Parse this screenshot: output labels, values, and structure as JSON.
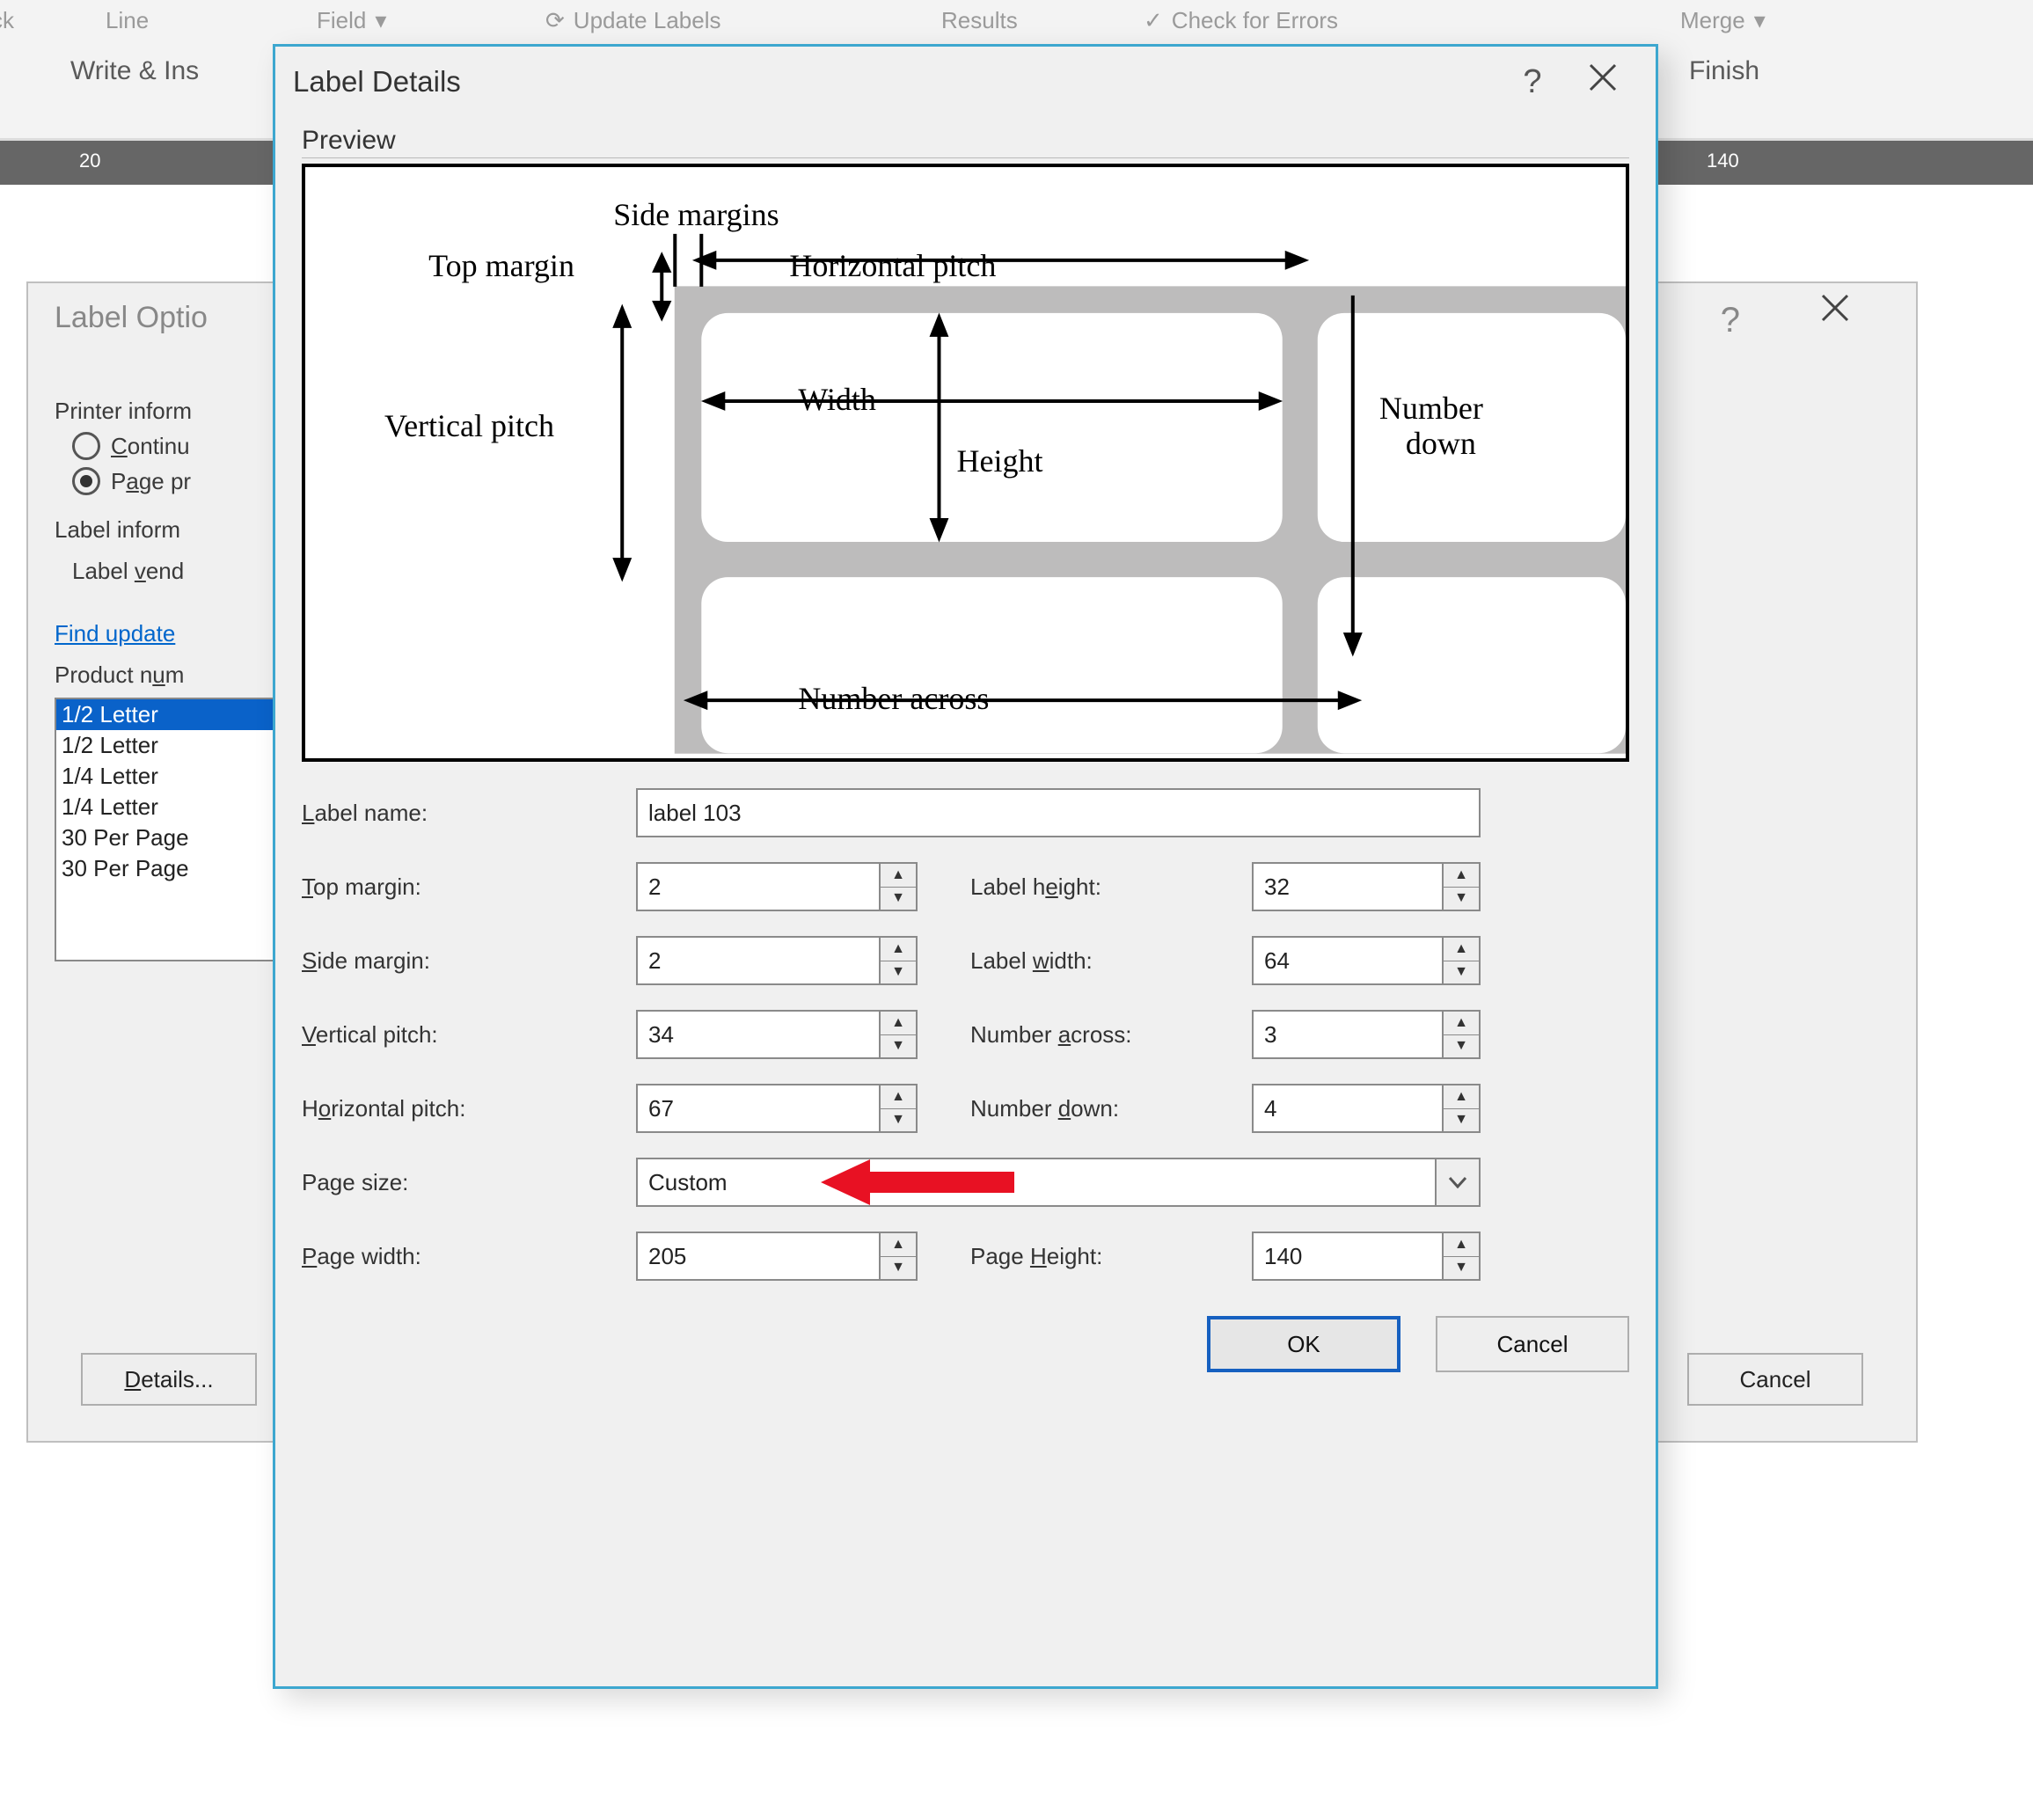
{
  "ribbon": {
    "ck": "ck",
    "line": "Line",
    "field": "Field",
    "update_labels": "Update Labels",
    "results": "Results",
    "check_errors": "Check for Errors",
    "merge": "Merge",
    "group_write": "Write & Ins",
    "group_finish": "Finish",
    "ruler_20": "20",
    "ruler_140": "140"
  },
  "label_options": {
    "title": "Label Optio",
    "help": "?",
    "section_printer": "Printer inform",
    "radio_continuous": "Continu",
    "radio_page": "Page pr",
    "section_labelinfo": "Label inform",
    "label_vendor": "Label vend",
    "find_updates": "Find update",
    "product_number": "Product num",
    "products": [
      "1/2 Letter",
      "1/2 Letter",
      "1/4 Letter",
      "1/4 Letter",
      "30 Per Page",
      "30 Per Page"
    ],
    "details_btn": "Details...",
    "cancel_btn": "Cancel"
  },
  "label_details": {
    "title": "Label Details",
    "help": "?",
    "preview_label": "Preview",
    "diagram": {
      "side_margins": "Side margins",
      "top_margin": "Top margin",
      "horizontal_pitch": "Horizontal pitch",
      "vertical_pitch": "Vertical pitch",
      "width": "Width",
      "height": "Height",
      "number_down": "Number down",
      "number_across": "Number across"
    },
    "fields": {
      "label_name_lbl": "Label name:",
      "label_name_val": "label 103",
      "top_margin_lbl": "Top margin:",
      "top_margin_val": "2",
      "side_margin_lbl": "Side margin:",
      "side_margin_val": "2",
      "vertical_pitch_lbl": "Vertical pitch:",
      "vertical_pitch_val": "34",
      "horizontal_pitch_lbl": "Horizontal pitch:",
      "horizontal_pitch_val": "67",
      "label_height_lbl": "Label height:",
      "label_height_val": "32",
      "label_width_lbl": "Label width:",
      "label_width_val": "64",
      "number_across_lbl": "Number across:",
      "number_across_val": "3",
      "number_down_lbl": "Number down:",
      "number_down_val": "4",
      "page_size_lbl": "Page size:",
      "page_size_val": "Custom",
      "page_width_lbl": "Page width:",
      "page_width_val": "205",
      "page_height_lbl": "Page Height:",
      "page_height_val": "140"
    },
    "ok": "OK",
    "cancel": "Cancel"
  }
}
